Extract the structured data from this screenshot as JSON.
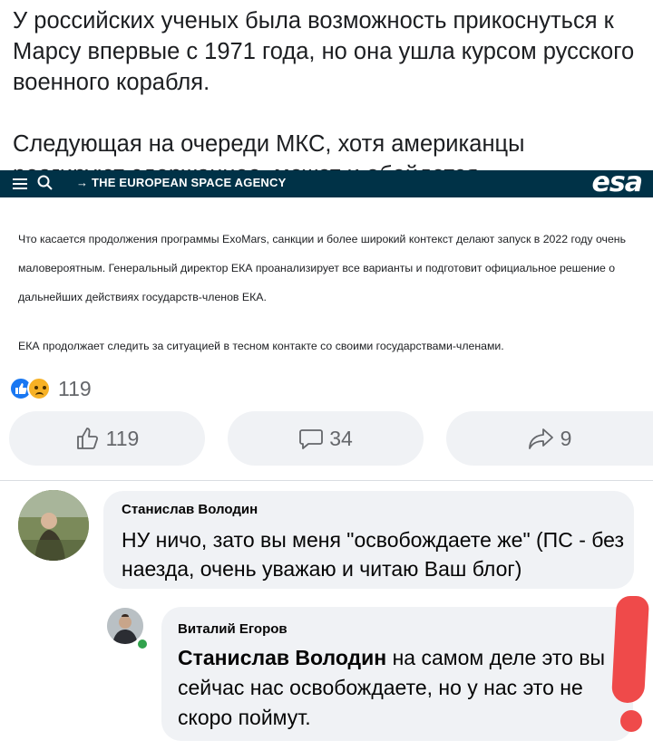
{
  "post": {
    "paragraph1": "У российских ученых была возможность прикоснуться к Марсу впервые с 1971 года, но она ушла курсом русского военного корабля.",
    "paragraph2": "Следующая на очереди МКС, хотя американцы реагируют сдержаннее, может и обойдется."
  },
  "esa": {
    "agency_label": "→ THE EUROPEAN SPACE AGENCY",
    "logo": "esa",
    "paragraph1": "Что касается продолжения программы ExoMars, санкции и более широкий контекст делают запуск в 2022 году очень маловероятным. Генеральный директор ЕКА проанализирует все варианты и подготовит официальное решение о дальнейших действиях государств-членов ЕКА.",
    "paragraph2": "ЕКА продолжает следить за ситуацией в тесном контакте со своими государствами-членами.",
    "bar_color": "#003247"
  },
  "reactions": {
    "icons": [
      "like-icon",
      "sad-icon"
    ],
    "count": "119"
  },
  "actions": {
    "like_count": "119",
    "comment_count": "34",
    "share_count": "9"
  },
  "comments": [
    {
      "author": "Станислав Володин",
      "text": "НУ ничо, зато вы меня \"освобождаете же\" (ПС - без наезда, очень уважаю и читаю Ваш блог)"
    },
    {
      "author": "Виталий Егоров",
      "mention": "Станислав Володин",
      "text": " на самом деле это вы сейчас нас освобождаете, но у нас это не скоро поймут."
    }
  ],
  "colors": {
    "accent": "#1877f2",
    "online": "#31a24c",
    "annotation": "#ef4a4a",
    "bubble": "#f0f2f5"
  }
}
